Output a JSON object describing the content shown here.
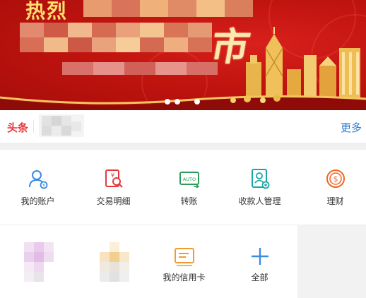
{
  "banner": {
    "title": "热烈",
    "brush_char": "市",
    "carousel": {
      "count": 3,
      "active": 2
    }
  },
  "headline": {
    "label": "头条",
    "more": "更多"
  },
  "grid_row1": [
    {
      "label": "我的账户",
      "icon": "account-icon",
      "color": "#3d8be0"
    },
    {
      "label": "交易明细",
      "icon": "transaction-detail-icon",
      "color": "#e4393c"
    },
    {
      "label": "转账",
      "icon": "transfer-icon",
      "color": "#2e9b5a"
    },
    {
      "label": "收款人管理",
      "icon": "payee-manage-icon",
      "color": "#1aa6a6"
    },
    {
      "label": "理财",
      "icon": "wealth-icon",
      "color": "#f26522"
    }
  ],
  "grid_row2": [
    {
      "label": "",
      "icon": "blurred-icon"
    },
    {
      "label": "",
      "icon": "blurred-icon"
    },
    {
      "label": "我的信用卡",
      "icon": "credit-card-icon",
      "color": "#f29b30"
    },
    {
      "label": "全部",
      "icon": "plus-icon",
      "color": "#3d8be0"
    }
  ],
  "colors": {
    "banner_red": "#c1140f",
    "headline_red": "#e4393c",
    "link_blue": "#2a7bd6"
  }
}
